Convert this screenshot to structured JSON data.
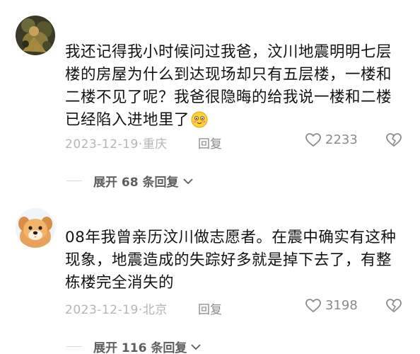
{
  "comments": [
    {
      "avatar_icon": "camo-figure-avatar",
      "text": "我还记得我小时候问过我爸，汶川地震明明七层楼的房屋为什么到达现场却只有五层楼，一楼和二楼不见了呢？我爸很隐晦的给我说一楼和二楼已经陷入进地里了",
      "emoji_icon": "blushing-smile-emoji",
      "date": "2023-12-19·重庆",
      "reply_label": "回复",
      "likes": "2233",
      "expand_label": "展开 68 条回复"
    },
    {
      "avatar_icon": "puppy-avatar",
      "text": "08年我曾亲历汶川做志愿者。在震中确实有这种现象，地震造成的失踪好多就是掉下去了，有整栋楼完全消失的",
      "date": "2023-12-19·北京",
      "reply_label": "回复",
      "likes": "3198",
      "expand_label": "展开 116 条回复"
    }
  ],
  "colors": {
    "text": "#121212",
    "meta": "#b5b5b5",
    "action": "#8a8a8a",
    "expand": "#5e5e5e"
  }
}
